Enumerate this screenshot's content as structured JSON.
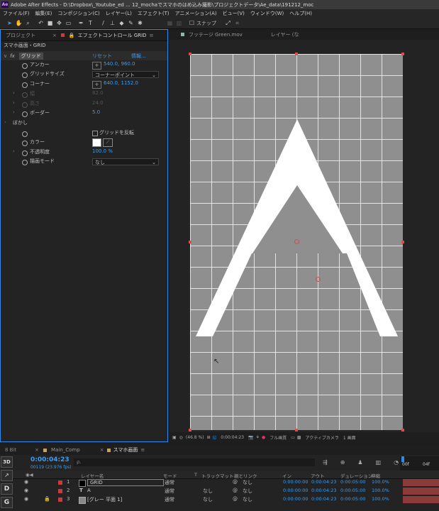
{
  "window": {
    "title": "Adobe After Effects - D:\\Dropbox\\_Youtube_ed ... 12_mochaでスマホのはめ込み撮影\\プロジェクトデータ\\Ae_data\\191212_moc",
    "logo": "Ae"
  },
  "menu": [
    "ファイル(F)",
    "編集(E)",
    "コンポジション(C)",
    "レイヤー(L)",
    "エフェクト(T)",
    "アニメーション(A)",
    "ビュー(V)",
    "ウィンドウ(W)",
    "ヘルプ(H)"
  ],
  "toolbar": {
    "snap_label": "スナップ"
  },
  "left_panel": {
    "tab_project": "プロジェクト",
    "tab_effect": "エフェクトコントロール GRID",
    "breadcrumb": "スマホ画面・GRID",
    "effect_name": "グリッド",
    "reset": "リセット",
    "info": "情報...",
    "props": [
      {
        "label": "アンカー",
        "value": "540.0, 960.0"
      },
      {
        "label": "グリッドサイズ",
        "value": "コーナーポイント"
      },
      {
        "label": "コーナー",
        "value": "640.0, 1152.0"
      },
      {
        "label": "幅",
        "value": "82.0"
      },
      {
        "label": "高さ",
        "value": "24.0"
      },
      {
        "label": "ボーダー",
        "value": "5.0"
      },
      {
        "label": "ぼかし",
        "value": ""
      },
      {
        "label": "",
        "value": "グリッドを反転"
      },
      {
        "label": "カラー",
        "value": ""
      },
      {
        "label": "不透明度",
        "value": "100.0 %"
      },
      {
        "label": "描画モード",
        "value": "なし"
      }
    ]
  },
  "viewer": {
    "tab_footage": "フッテージ Green.mov",
    "tab_layer": "レイヤー (な",
    "letter": "A",
    "zoom": "(46.8 %)",
    "timecode": "0:00:04:23",
    "resolution": "フル画質",
    "camera": "アクティブカメラ",
    "views": "1 画面"
  },
  "timeline": {
    "tab_bits": "8 Bit",
    "tab_main": "Main_Comp",
    "tab_active": "スマホ画面",
    "timecode": "0:00:04:23",
    "frame_info": "00119 (23.976 fps)",
    "search_placeholder": "ρ.",
    "columns": {
      "layer": "レイヤー名",
      "mode": "モード",
      "t": "T",
      "trkmat": "トラックマット",
      "parent": "親とリンク",
      "in": "イン",
      "out": "アウト",
      "dur": "デュレーション",
      "stretch": "伸縮"
    },
    "ruler": [
      "00f",
      "04f"
    ],
    "side": [
      "3D",
      "D",
      "G"
    ],
    "layers": [
      {
        "num": "1",
        "name": "GRID",
        "color": "#c83c3c",
        "mode": "通常",
        "trk": "",
        "parent": "なし",
        "in": "0:00:00:00",
        "out": "0:00:04:23",
        "dur": "0:00:05:00",
        "stretch": "100.0%"
      },
      {
        "num": "2",
        "name": "A",
        "color": "#c83c3c",
        "mode": "通常",
        "trk": "なし",
        "parent": "なし",
        "in": "0:00:00:00",
        "out": "0:00:04:23",
        "dur": "0:00:05:00",
        "stretch": "100.0%"
      },
      {
        "num": "3",
        "name": "[グレー 平面 1]",
        "color": "#c83c3c",
        "mode": "通常",
        "trk": "なし",
        "parent": "なし",
        "in": "0:00:00:00",
        "out": "0:00:04:23",
        "dur": "0:00:05:00",
        "stretch": "100.0%"
      }
    ]
  },
  "colors": {
    "accent": "#2d8ceb",
    "value_blue": "#3e9cf0",
    "label_red": "#c83c3c"
  }
}
